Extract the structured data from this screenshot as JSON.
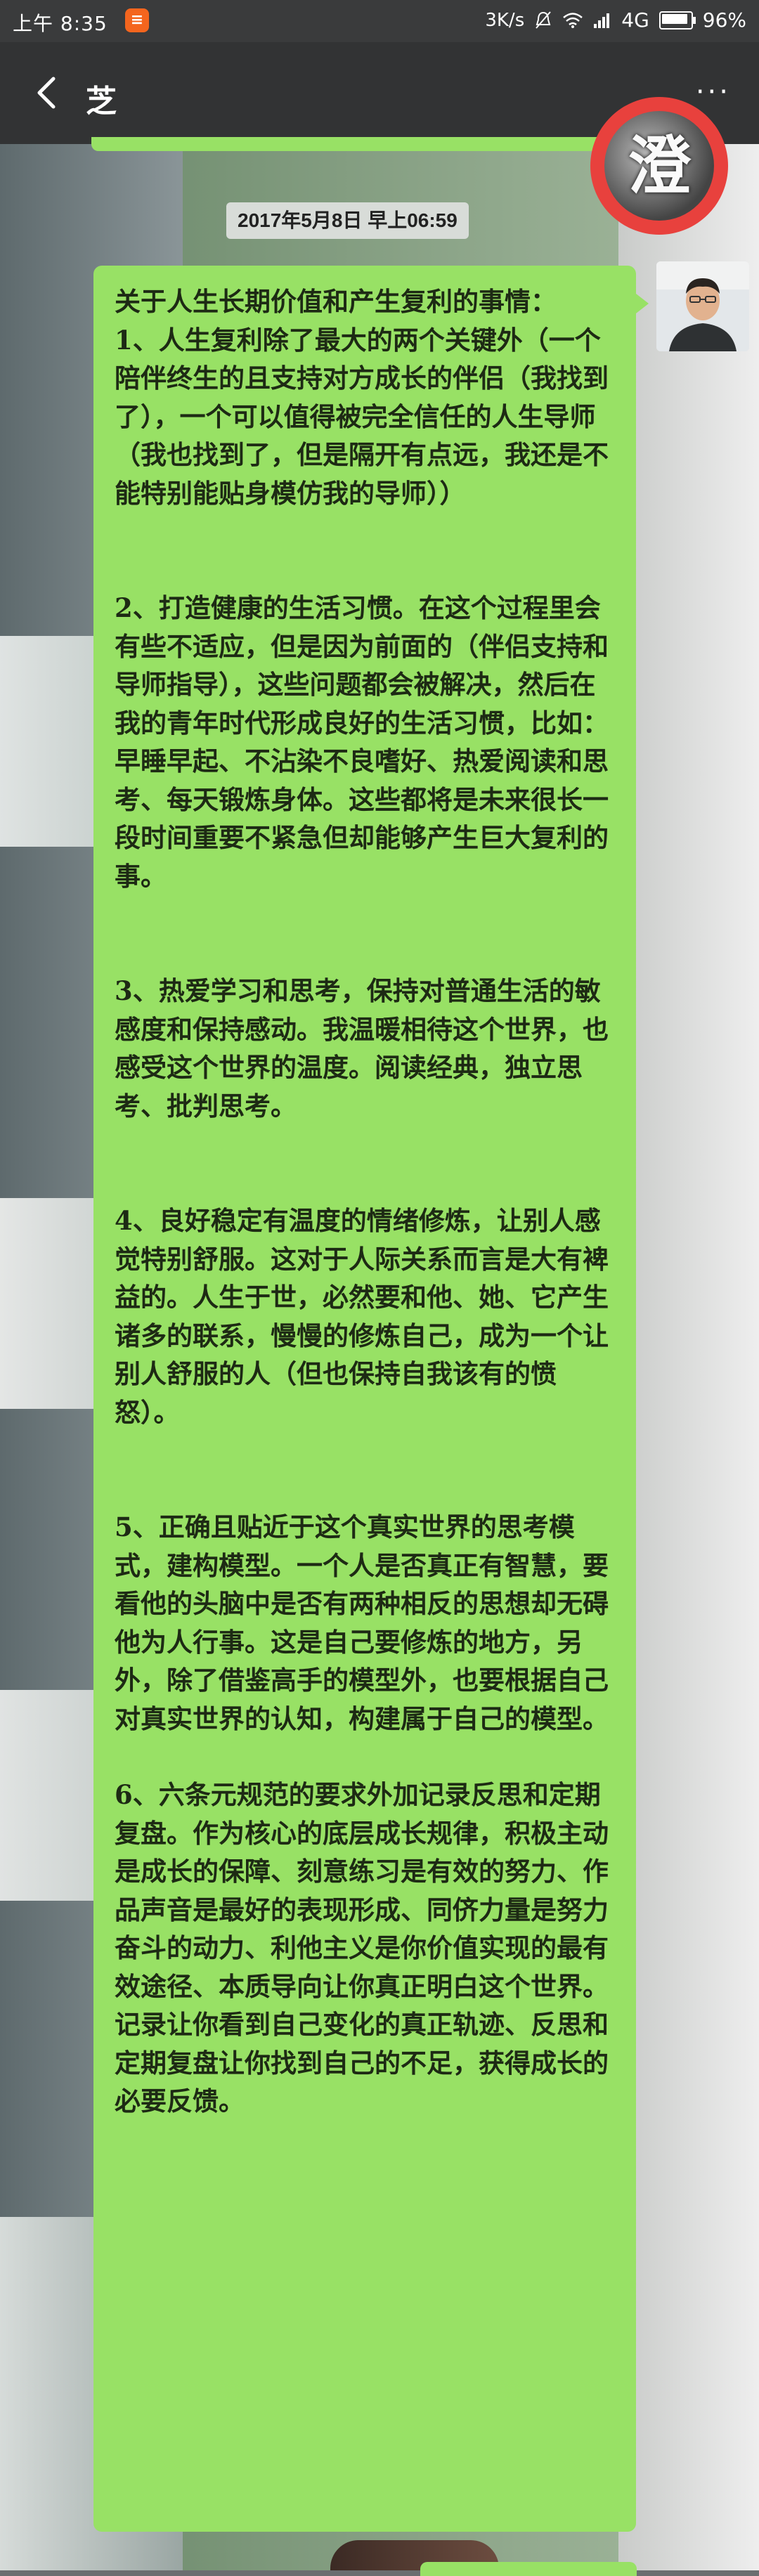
{
  "status_bar": {
    "time": "上午 8:35",
    "notification_badge": "≡",
    "network_speed": "3K/s",
    "signal_label": "4G",
    "battery_percent": "96%"
  },
  "nav": {
    "title": "芝",
    "more_label": "···"
  },
  "sticker": {
    "glyph": "澄"
  },
  "chat": {
    "timestamp": "2017年5月8日  早上06:59",
    "message": {
      "intro": "关于人生长期价值和产生复利的事情：",
      "p1": "1、人生复利除了最大的两个关键外（一个陪伴终生的且支持对方成长的伴侣（我找到了），一个可以值得被完全信任的人生导师（我也找到了，但是隔开有点远，我还是不能特别能贴身模仿我的导师））",
      "p2": "2、打造健康的生活习惯。在这个过程里会有些不适应，但是因为前面的（伴侣支持和导师指导），这些问题都会被解决，然后在我的青年时代形成良好的生活习惯，比如：早睡早起、不沾染不良嗜好、热爱阅读和思考、每天锻炼身体。这些都将是未来很长一段时间重要不紧急但却能够产生巨大复利的事。",
      "p3": "3、热爱学习和思考，保持对普通生活的敏感度和保持感动。我温暖相待这个世界，也感受这个世界的温度。阅读经典，独立思考、批判思考。",
      "p4": "4、良好稳定有温度的情绪修炼，让别人感觉特别舒服。这对于人际关系而言是大有裨益的。人生于世，必然要和他、她、它产生诸多的联系，慢慢的修炼自己，成为一个让别人舒服的人（但也保持自我该有的愤怒）。",
      "p5": "5、正确且贴近于这个真实世界的思考模式，建构模型。一个人是否真正有智慧，要看他的头脑中是否有两种相反的思想却无碍他为人行事。这是自己要修炼的地方，另外，除了借鉴高手的模型外，也要根据自己对真实世界的认知，构建属于自己的模型。",
      "p6": "6、六条元规范的要求外加记录反思和定期复盘。作为核心的底层成长规律，积极主动是成长的保障、刻意练习是有效的努力、作品声音是最好的表现形成、同侪力量是努力奋斗的动力、利他主义是你价值实现的最有效途径、本质导向让你真正明白这个世界。记录让你看到自己变化的真正轨迹、反思和定期复盘让你找到自己的不足，获得成长的必要反馈。"
    }
  },
  "colors": {
    "bubble": "#98e165",
    "nav_bg": "#323334",
    "status_bg": "#3a3b3c",
    "sticker_ring": "#e8413d",
    "timestamp_bg": "#d8dcd8"
  }
}
